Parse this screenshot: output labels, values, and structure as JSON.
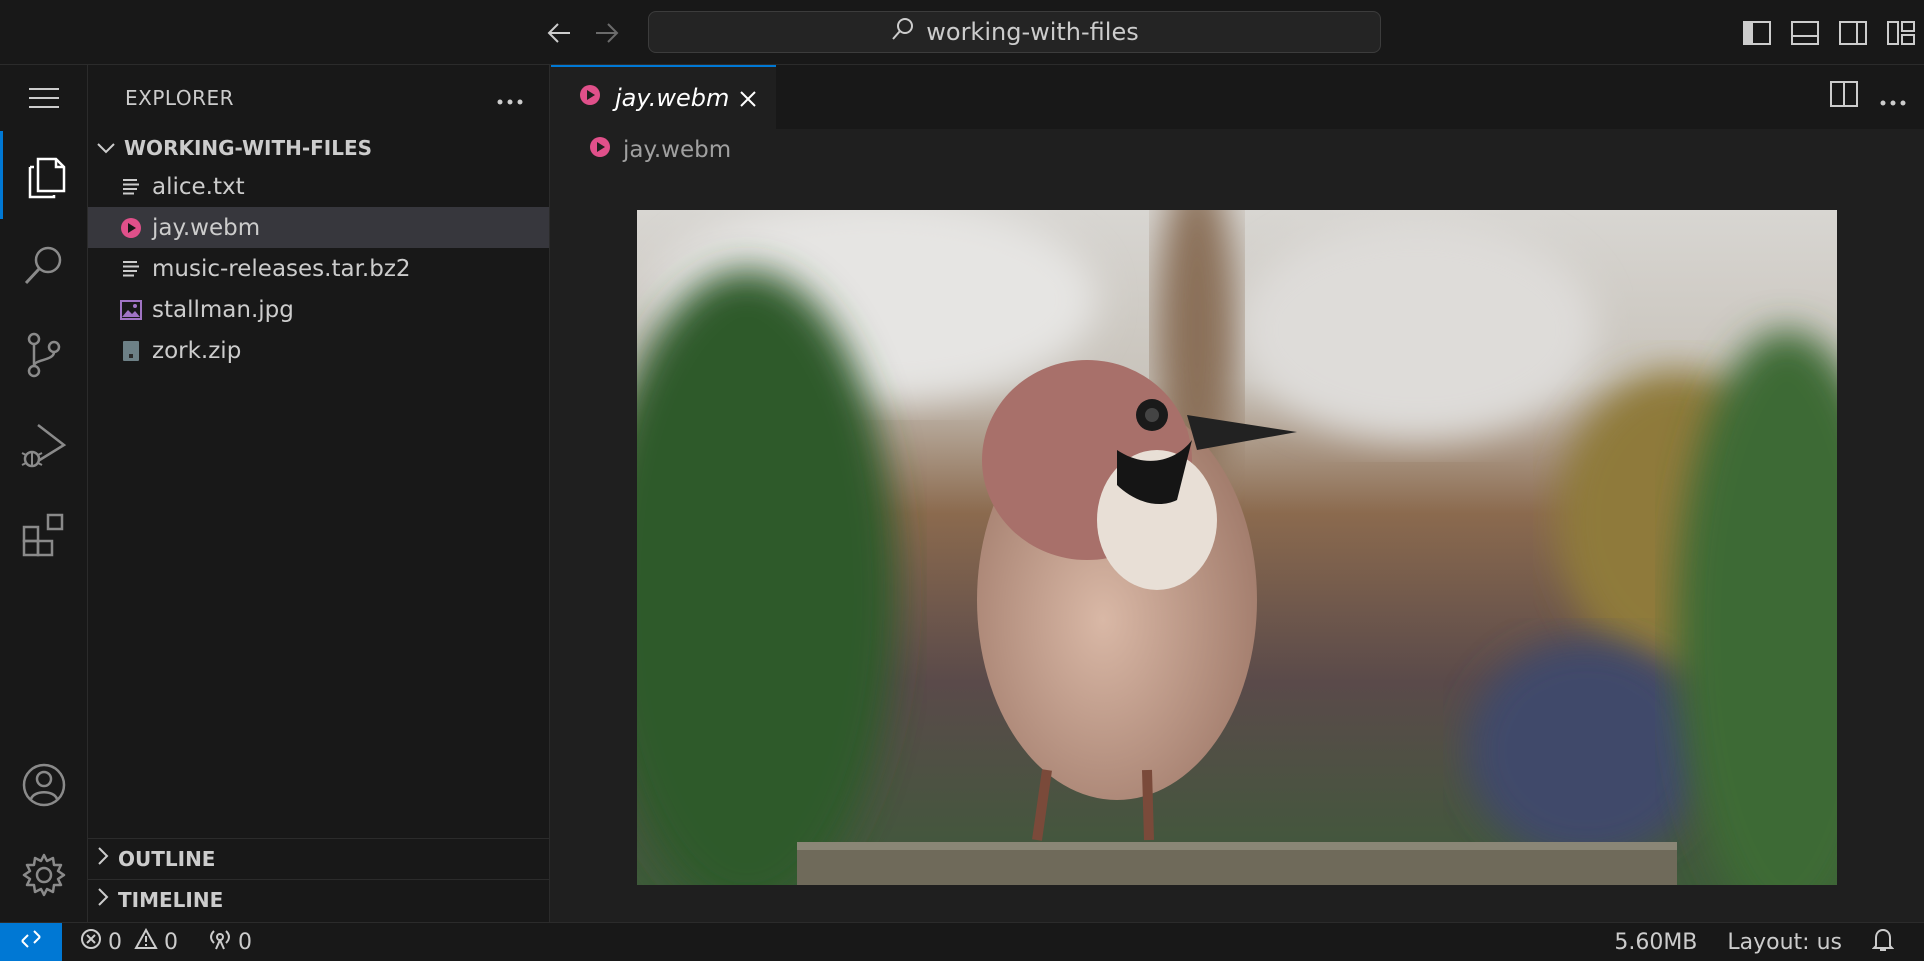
{
  "titlebar": {
    "search_text": "working-with-files"
  },
  "sidebar": {
    "title": "EXPLORER",
    "folder_name": "WORKING-WITH-FILES",
    "files": [
      {
        "name": "alice.txt",
        "icon": "text-file-icon"
      },
      {
        "name": "jay.webm",
        "icon": "video-file-icon",
        "selected": true
      },
      {
        "name": "music-releases.tar.bz2",
        "icon": "text-file-icon"
      },
      {
        "name": "stallman.jpg",
        "icon": "image-file-icon"
      },
      {
        "name": "zork.zip",
        "icon": "zip-file-icon"
      }
    ],
    "outline_label": "OUTLINE",
    "timeline_label": "TIMELINE"
  },
  "editor": {
    "tab_label": "jay.webm",
    "breadcrumb": "jay.webm"
  },
  "statusbar": {
    "errors": "0",
    "warnings": "0",
    "ports": "0",
    "file_size": "5.60MB",
    "layout": "Layout: us"
  },
  "colors": {
    "accent": "#0078d4",
    "video_icon": "#e0508a",
    "image_icon": "#a074c4"
  }
}
